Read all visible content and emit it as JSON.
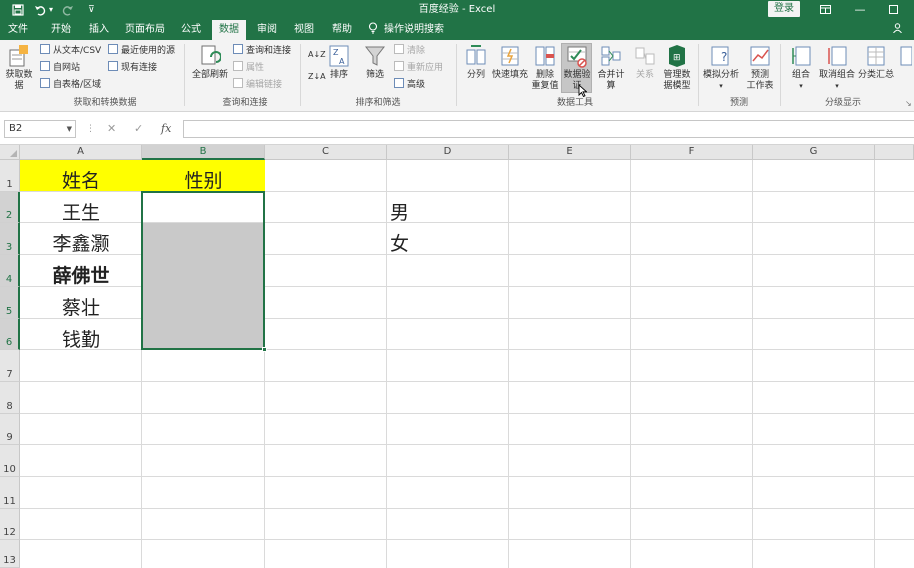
{
  "app": {
    "title": "百度经验 - Excel",
    "login_label": "登录",
    "share_label": "共"
  },
  "quick_access": {
    "save_icon": "save-icon",
    "undo_icon": "undo-icon",
    "redo_icon": "redo-icon",
    "customize_icon": "customize-icon"
  },
  "tabs": [
    {
      "label": "文件"
    },
    {
      "label": "开始"
    },
    {
      "label": "插入"
    },
    {
      "label": "页面布局"
    },
    {
      "label": "公式"
    },
    {
      "label": "数据"
    },
    {
      "label": "审阅"
    },
    {
      "label": "视图"
    },
    {
      "label": "帮助"
    },
    {
      "label": "操作说明搜索"
    }
  ],
  "ribbon": {
    "get_data": "获取数\n据",
    "from_text_csv": "从文本/CSV",
    "from_web": "自网站",
    "from_table": "自表格/区域",
    "recent_sources": "最近使用的源",
    "existing_connections": "现有连接",
    "group_get_transform": "获取和转换数据",
    "refresh_all": "全部刷新",
    "queries_connections": "查询和连接",
    "properties": "属性",
    "edit_links": "编辑链接",
    "group_queries": "查询和连接",
    "sort_label": "排序",
    "filter_label": "筛选",
    "clear_label": "清除",
    "reapply_label": "重新应用",
    "advanced_label": "高级",
    "group_sort_filter": "排序和筛选",
    "text_to_columns": "分列",
    "flash_fill": "快速填充",
    "remove_duplicates": "删除\n重复值",
    "data_validation": "数据验\n证",
    "consolidate": "合并计算",
    "relationships": "关系",
    "manage_data_model": "管理数\n据模型",
    "group_data_tools": "数据工具",
    "what_if": "模拟分析",
    "forecast_sheet": "预测\n工作表",
    "group_forecast": "预测",
    "group_btn": "组合",
    "ungroup_btn": "取消组合",
    "subtotal_btn": "分类汇总",
    "group_outline": "分级显示"
  },
  "formula_bar": {
    "name_box": "B2",
    "cancel": "✕",
    "enter": "✓",
    "fx": "fx",
    "value": ""
  },
  "columns": [
    "A",
    "B",
    "C",
    "D",
    "E",
    "F",
    "G"
  ],
  "rows": [
    "1",
    "2",
    "3",
    "4",
    "5",
    "6",
    "7",
    "8",
    "9",
    "10",
    "11",
    "12",
    "13"
  ],
  "cells": {
    "A1": "姓名",
    "B1": "性别",
    "A2": "王生",
    "A3": "李鑫灏",
    "A4": "薛佛世",
    "A5": "蔡壮",
    "A6": "钱勤",
    "D2": "男",
    "D3": "女"
  },
  "colors": {
    "accent": "#217346",
    "header_fill": "#ffff00",
    "selection_fill": "#c9c9c9"
  }
}
